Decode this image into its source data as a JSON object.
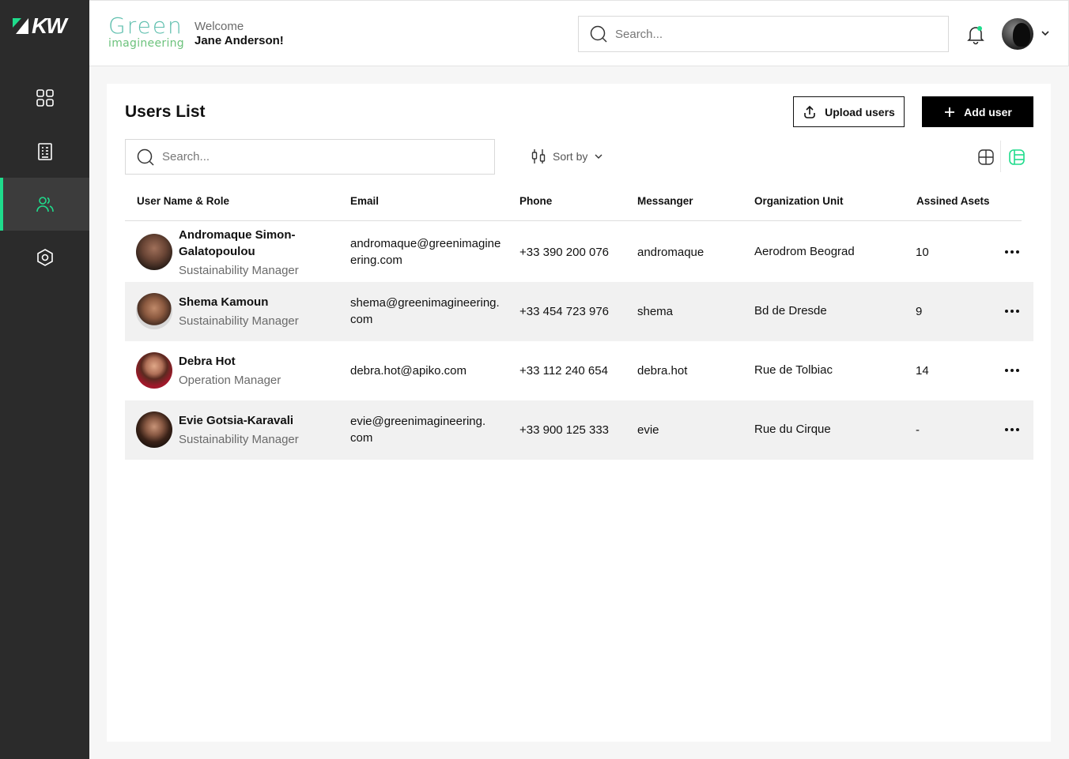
{
  "app": {
    "logo_text": "KW",
    "brand_top": "Green",
    "brand_bottom": "imagineering",
    "accent": "#1fdc8c"
  },
  "header": {
    "welcome_label": "Welcome",
    "user_name": "Jane Anderson!",
    "search_placeholder": "Search..."
  },
  "sidebar": {
    "items": [
      {
        "name": "dashboard",
        "icon": "grid-icon"
      },
      {
        "name": "reports",
        "icon": "document-icon"
      },
      {
        "name": "users",
        "icon": "users-icon",
        "active": true
      },
      {
        "name": "settings",
        "icon": "hexagon-settings-icon"
      }
    ]
  },
  "users_list": {
    "title": "Users List",
    "upload_label": "Upload users",
    "add_label": "Add user",
    "search_placeholder": "Search...",
    "sort_label": "Sort by",
    "columns": [
      "User Name & Role",
      "Email",
      "Phone",
      "Messanger",
      "Organization Unit",
      "Assined Asets"
    ],
    "rows": [
      {
        "name_line1": "Andromaque Simon-",
        "name_line2": "Galatopoulou",
        "role": "Sustainability Manager",
        "email_line1": "andromaque@greenimagine",
        "email_line2": "ering.com",
        "phone": "+33 390 200 076",
        "messenger": "andromaque",
        "org": "Aerodrom Beograd",
        "assets": "10"
      },
      {
        "name_line1": "Shema Kamoun",
        "name_line2": "",
        "role": "Sustainability Manager",
        "email_line1": "shema@greenimagineering.",
        "email_line2": "com",
        "phone": "+33 454 723 976",
        "messenger": "shema",
        "org": "Bd de Dresde",
        "assets": "9"
      },
      {
        "name_line1": "Debra Hot",
        "name_line2": "",
        "role": "Operation Manager",
        "email_line1": "debra.hot@apiko.com",
        "email_line2": "",
        "phone": "+33 112 240 654",
        "messenger": "debra.hot",
        "org": "Rue de Tolbiac",
        "assets": "14"
      },
      {
        "name_line1": "Evie Gotsia-Karavali",
        "name_line2": "",
        "role": "Sustainability Manager",
        "email_line1": "evie@greenimagineering.",
        "email_line2": "com",
        "phone": "+33 900 125 333",
        "messenger": "evie",
        "org": "Rue du Cirque",
        "assets": "-"
      }
    ]
  }
}
